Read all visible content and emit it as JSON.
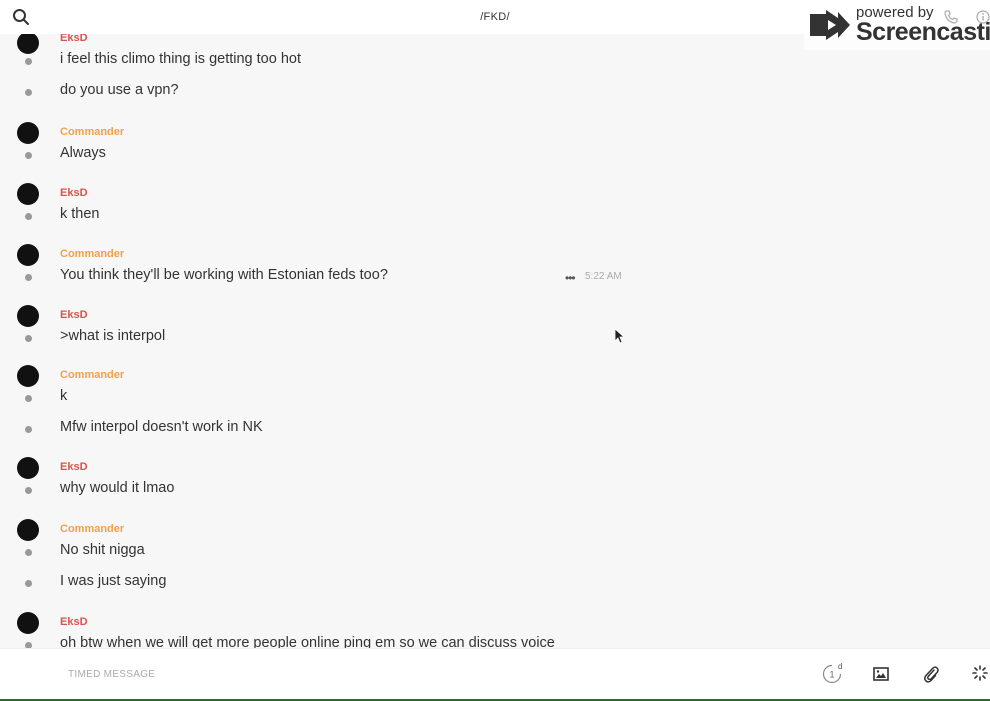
{
  "header": {
    "title": "/FKD/",
    "search_icon": "search-icon"
  },
  "watermark": {
    "powered_by": "powered by",
    "brand": "Screencastify"
  },
  "colors": {
    "eksd": "#d9534f",
    "commander": "#f0a04b",
    "avatar": "#111111",
    "dot": "#999999"
  },
  "messages": [
    {
      "author": "EksD",
      "lines": [
        "i feel this climo thing is getting too hot",
        "do you use a vpn?"
      ]
    },
    {
      "author": "Commander",
      "lines": [
        "Always"
      ]
    },
    {
      "author": "EksD",
      "lines": [
        "k then"
      ]
    },
    {
      "author": "Commander",
      "lines": [
        "You think they'll be working with Estonian feds too?"
      ],
      "time": "5:22 AM"
    },
    {
      "author": "EksD",
      "lines": [
        ">what is interpol"
      ]
    },
    {
      "author": "Commander",
      "lines": [
        "k",
        "Mfw interpol doesn't work in NK"
      ]
    },
    {
      "author": "EksD",
      "lines": [
        "why would it lmao"
      ]
    },
    {
      "author": "Commander",
      "lines": [
        "No shit nigga",
        "I was just saying"
      ]
    },
    {
      "author": "EksD",
      "lines": [
        "oh btw when we will get more people online ping em so we can discuss voice"
      ]
    }
  ],
  "composer": {
    "placeholder": "TIMED MESSAGE",
    "timer_value": "1",
    "timer_unit": "d"
  }
}
